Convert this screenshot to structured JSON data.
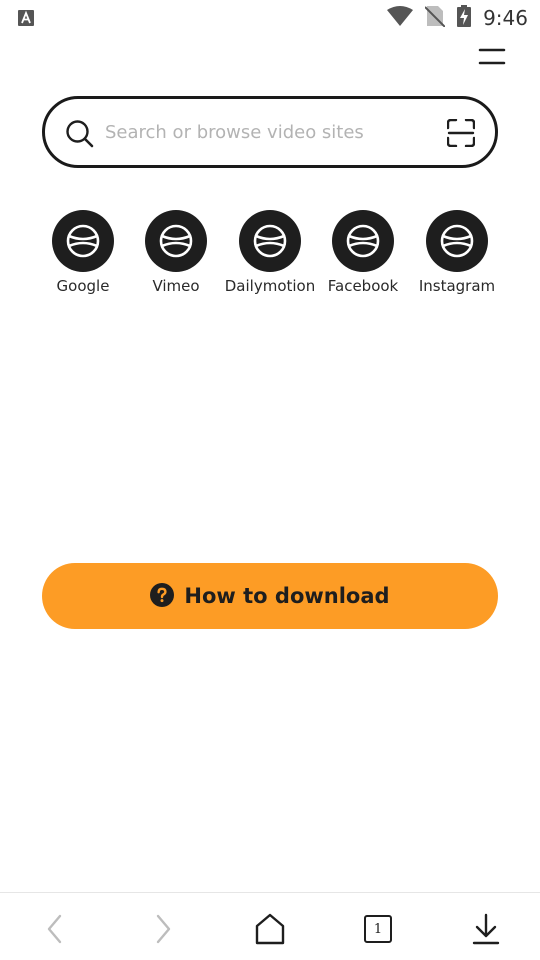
{
  "status_bar": {
    "time": "9:46",
    "icons": [
      "app-notification-icon",
      "wifi-icon",
      "no-sim-icon",
      "battery-charging-icon"
    ]
  },
  "search": {
    "placeholder": "Search or browse video sites",
    "value": ""
  },
  "sites": [
    {
      "label": "Google",
      "icon": "globe-icon"
    },
    {
      "label": "Vimeo",
      "icon": "globe-icon"
    },
    {
      "label": "Dailymotion",
      "icon": "globe-icon"
    },
    {
      "label": "Facebook",
      "icon": "globe-icon"
    },
    {
      "label": "Instagram",
      "icon": "globe-icon"
    }
  ],
  "howto": {
    "label": "How to download",
    "icon": "question-circle-icon"
  },
  "bottom_nav": {
    "tab_count": "1",
    "items": [
      "back-icon",
      "forward-icon",
      "home-icon",
      "tabs-icon",
      "download-icon"
    ]
  },
  "colors": {
    "accent": "#fd9c25",
    "dark": "#1e1e1e",
    "placeholder": "#b3b3b3",
    "disabled": "#bdbdbd"
  }
}
